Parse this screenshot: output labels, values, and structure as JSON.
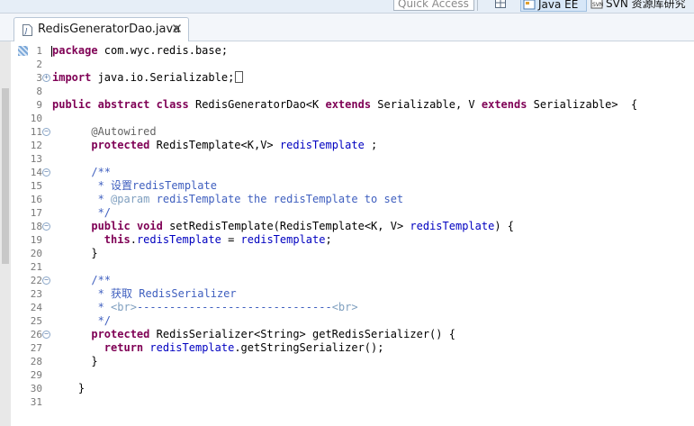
{
  "toolbar": {
    "quick_access_placeholder": "Quick Access",
    "perspectives": [
      {
        "label": "Java EE"
      },
      {
        "label": "SVN 资源库研究"
      }
    ]
  },
  "editor_tab": {
    "file_name": "RedisGeneratorDao.java"
  },
  "code_lines": [
    {
      "n": "1",
      "fold": "",
      "tokens": [
        {
          "t": "package",
          "c": "kw"
        },
        {
          "t": " com.wyc.redis.base;",
          "c": ""
        }
      ],
      "cursor": true
    },
    {
      "n": "2",
      "fold": "",
      "tokens": []
    },
    {
      "n": "3",
      "fold": "plus",
      "tokens": [
        {
          "t": "import",
          "c": "kw"
        },
        {
          "t": " java.io.Serializable;",
          "c": ""
        }
      ],
      "folded": true
    },
    {
      "n": "8",
      "fold": "",
      "tokens": []
    },
    {
      "n": "9",
      "fold": "",
      "tokens": [
        {
          "t": "public",
          "c": "kw"
        },
        {
          "t": " ",
          "c": ""
        },
        {
          "t": "abstract",
          "c": "kw"
        },
        {
          "t": " ",
          "c": ""
        },
        {
          "t": "class",
          "c": "kw"
        },
        {
          "t": " RedisGeneratorDao<K ",
          "c": ""
        },
        {
          "t": "extends",
          "c": "kw"
        },
        {
          "t": " Serializable, V ",
          "c": ""
        },
        {
          "t": "extends",
          "c": "kw"
        },
        {
          "t": " Serializable>  {",
          "c": ""
        }
      ]
    },
    {
      "n": "10",
      "fold": "",
      "tokens": []
    },
    {
      "n": "11",
      "fold": "minus",
      "tokens": [
        {
          "t": "      ",
          "c": ""
        },
        {
          "t": "@Autowired",
          "c": "ann"
        }
      ]
    },
    {
      "n": "12",
      "fold": "",
      "tokens": [
        {
          "t": "      ",
          "c": ""
        },
        {
          "t": "protected",
          "c": "kw"
        },
        {
          "t": " RedisTemplate<K,V> ",
          "c": ""
        },
        {
          "t": "redisTemplate",
          "c": "fld"
        },
        {
          "t": " ;",
          "c": ""
        }
      ]
    },
    {
      "n": "13",
      "fold": "",
      "tokens": []
    },
    {
      "n": "14",
      "fold": "minus",
      "tokens": [
        {
          "t": "      ",
          "c": ""
        },
        {
          "t": "/**",
          "c": "cm"
        }
      ]
    },
    {
      "n": "15",
      "fold": "",
      "tokens": [
        {
          "t": "       * 设置redisTemplate",
          "c": "cm"
        }
      ]
    },
    {
      "n": "16",
      "fold": "",
      "tokens": [
        {
          "t": "       * ",
          "c": "cm"
        },
        {
          "t": "@param",
          "c": "cmt"
        },
        {
          "t": " redisTemplate the redisTemplate to set",
          "c": "cm"
        }
      ]
    },
    {
      "n": "17",
      "fold": "",
      "tokens": [
        {
          "t": "       */",
          "c": "cm"
        }
      ]
    },
    {
      "n": "18",
      "fold": "minus",
      "tokens": [
        {
          "t": "      ",
          "c": ""
        },
        {
          "t": "public",
          "c": "kw"
        },
        {
          "t": " ",
          "c": ""
        },
        {
          "t": "void",
          "c": "kw"
        },
        {
          "t": " setRedisTemplate(RedisTemplate<K, V> ",
          "c": ""
        },
        {
          "t": "redisTemplate",
          "c": "fld"
        },
        {
          "t": ") {",
          "c": ""
        }
      ]
    },
    {
      "n": "19",
      "fold": "",
      "tokens": [
        {
          "t": "        ",
          "c": ""
        },
        {
          "t": "this",
          "c": "kw"
        },
        {
          "t": ".",
          "c": ""
        },
        {
          "t": "redisTemplate",
          "c": "fld"
        },
        {
          "t": " = ",
          "c": ""
        },
        {
          "t": "redisTemplate",
          "c": "fld"
        },
        {
          "t": ";",
          "c": ""
        }
      ]
    },
    {
      "n": "20",
      "fold": "",
      "tokens": [
        {
          "t": "      }",
          "c": ""
        }
      ]
    },
    {
      "n": "21",
      "fold": "",
      "tokens": []
    },
    {
      "n": "22",
      "fold": "minus",
      "tokens": [
        {
          "t": "      ",
          "c": ""
        },
        {
          "t": "/**",
          "c": "cm"
        }
      ]
    },
    {
      "n": "23",
      "fold": "",
      "tokens": [
        {
          "t": "       * 获取 RedisSerializer",
          "c": "cm"
        }
      ]
    },
    {
      "n": "24",
      "fold": "",
      "tokens": [
        {
          "t": "       * ",
          "c": "cm"
        },
        {
          "t": "<br>",
          "c": "cmt"
        },
        {
          "t": "------------------------------",
          "c": "cm"
        },
        {
          "t": "<br>",
          "c": "cmt"
        }
      ]
    },
    {
      "n": "25",
      "fold": "",
      "tokens": [
        {
          "t": "       */",
          "c": "cm"
        }
      ]
    },
    {
      "n": "26",
      "fold": "minus",
      "tokens": [
        {
          "t": "      ",
          "c": ""
        },
        {
          "t": "protected",
          "c": "kw"
        },
        {
          "t": " RedisSerializer<String> getRedisSerializer() {",
          "c": ""
        }
      ]
    },
    {
      "n": "27",
      "fold": "",
      "tokens": [
        {
          "t": "        ",
          "c": ""
        },
        {
          "t": "return",
          "c": "kw"
        },
        {
          "t": " ",
          "c": ""
        },
        {
          "t": "redisTemplate",
          "c": "fld"
        },
        {
          "t": ".getStringSerializer();",
          "c": ""
        }
      ]
    },
    {
      "n": "28",
      "fold": "",
      "tokens": [
        {
          "t": "      }",
          "c": ""
        }
      ]
    },
    {
      "n": "29",
      "fold": "",
      "tokens": []
    },
    {
      "n": "30",
      "fold": "",
      "tokens": [
        {
          "t": "    }",
          "c": ""
        }
      ]
    },
    {
      "n": "31",
      "fold": "",
      "tokens": []
    }
  ]
}
